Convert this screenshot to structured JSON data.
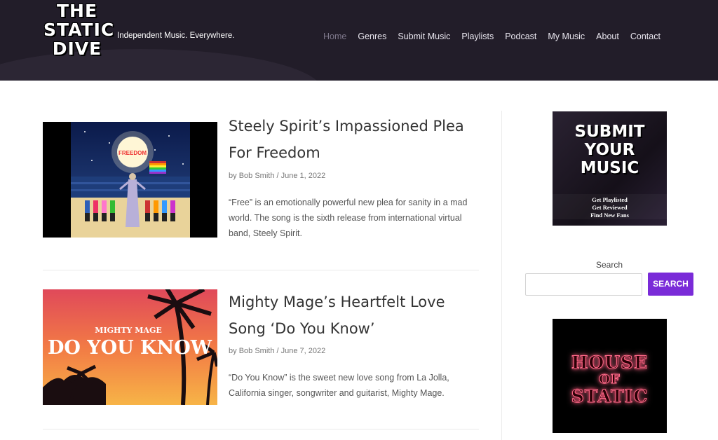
{
  "header": {
    "logo_lines": [
      "THE",
      "STATIC",
      "DIVE"
    ],
    "tagline": "Independent Music. Everywhere.",
    "nav": [
      "Home",
      "Genres",
      "Submit Music",
      "Playlists",
      "Podcast",
      "My Music",
      "About",
      "Contact"
    ],
    "active_nav": "Home"
  },
  "posts": [
    {
      "title": "Steely Spirit’s Impassioned Plea For Freedom",
      "author": "Bob Smith",
      "date": "June 1, 2022",
      "excerpt": "“Free” is an emotionally powerful new plea for sanity in a mad world. The song is the sixth release from international virtual band, Steely Spirit.",
      "thumb_text": "FREEDOM"
    },
    {
      "title": "Mighty Mage’s Heartfelt Love Song ‘Do You Know’",
      "author": "Bob Smith",
      "date": "June 7, 2022",
      "excerpt": "“Do You Know” is the sweet new love song from La Jolla, California singer, songwriter and guitarist, Mighty Mage.",
      "thumb_text_top": "MIGHTY MAGE",
      "thumb_text_main": "DO YOU KNOW"
    }
  ],
  "meta": {
    "by": "by",
    "sep": "/"
  },
  "sidebar": {
    "submit_ad_lines": [
      "SUBMIT",
      "YOUR",
      "MUSIC"
    ],
    "submit_ad_sub": [
      "Get Playlisted",
      "Get Reviewed",
      "Find New Fans"
    ],
    "search_label": "Search",
    "search_button": "SEARCH",
    "house_ad_lines": [
      "HOUSE",
      "OF",
      "STATIC"
    ]
  },
  "colors": {
    "header_bg": "#221d29",
    "accent": "#7a2bd8",
    "nav_active": "#7d778a"
  }
}
